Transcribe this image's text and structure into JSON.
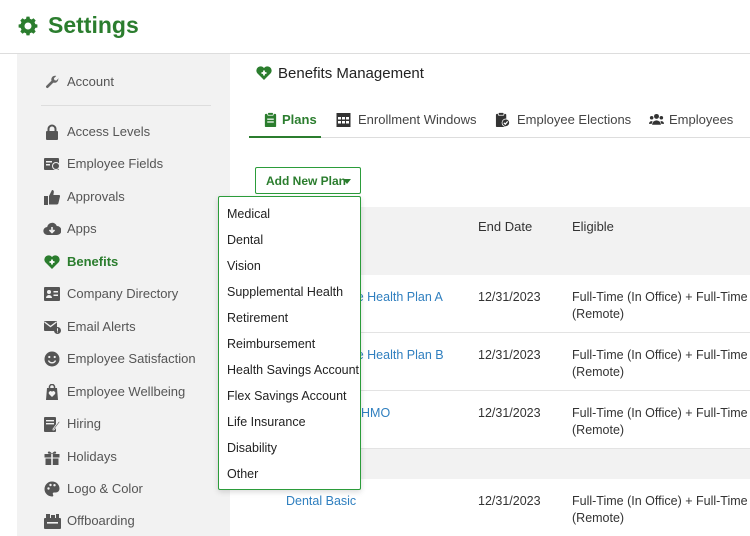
{
  "header": {
    "title": "Settings"
  },
  "sidebar": {
    "items": [
      {
        "label": "Account",
        "icon": "wrench-icon"
      },
      {
        "label": "Access Levels",
        "icon": "lock-icon"
      },
      {
        "label": "Employee Fields",
        "icon": "id-card-icon"
      },
      {
        "label": "Approvals",
        "icon": "thumbs-up-icon"
      },
      {
        "label": "Apps",
        "icon": "cloud-download-icon"
      },
      {
        "label": "Benefits",
        "icon": "heart-plus-icon",
        "active": true
      },
      {
        "label": "Company Directory",
        "icon": "address-card-icon"
      },
      {
        "label": "Email Alerts",
        "icon": "email-alert-icon"
      },
      {
        "label": "Employee Satisfaction",
        "icon": "smile-icon"
      },
      {
        "label": "Employee Wellbeing",
        "icon": "wellbeing-icon"
      },
      {
        "label": "Hiring",
        "icon": "hiring-icon"
      },
      {
        "label": "Holidays",
        "icon": "gift-icon"
      },
      {
        "label": "Logo & Color",
        "icon": "palette-icon"
      },
      {
        "label": "Offboarding",
        "icon": "offboarding-icon"
      }
    ]
  },
  "main": {
    "title": "Benefits Management",
    "tabs": [
      {
        "label": "Plans",
        "icon": "clipboard-icon",
        "active": true
      },
      {
        "label": "Enrollment Windows",
        "icon": "calendar-icon"
      },
      {
        "label": "Employee Elections",
        "icon": "clipboard-check-icon"
      },
      {
        "label": "Employees",
        "icon": "users-icon"
      }
    ],
    "add_button": "Add New Plan",
    "table": {
      "headers": {
        "end_date": "End Date",
        "eligible": "Eligible"
      },
      "rows": [
        {
          "name": "ble Health Plan A",
          "end": "12/31/2023",
          "elig1": "Full-Time (In Office) + Full-Time",
          "elig2": "(Remote)"
        },
        {
          "name": "ble Health Plan B",
          "end": "12/31/2023",
          "elig1": "Full-Time (In Office) + Full-Time",
          "elig2": "(Remote)"
        },
        {
          "name": "HMO",
          "end": "12/31/2023",
          "elig1": "Full-Time (In Office) + Full-Time",
          "elig2": "(Remote)"
        },
        {
          "name": "Dental Basic",
          "end": "12/31/2023",
          "elig1": "Full-Time (In Office) + Full-Time",
          "elig2": "(Remote)"
        }
      ]
    }
  },
  "dropdown": {
    "items": [
      "Medical",
      "Dental",
      "Vision",
      "Supplemental Health",
      "Retirement",
      "Reimbursement",
      "Health Savings Account",
      "Flex Savings Account",
      "Life Insurance",
      "Disability",
      "Other"
    ]
  },
  "colors": {
    "brand_green": "#2b7d2e",
    "link_blue": "#2f7fbf",
    "sidebar_bg": "#f2f2f2"
  }
}
